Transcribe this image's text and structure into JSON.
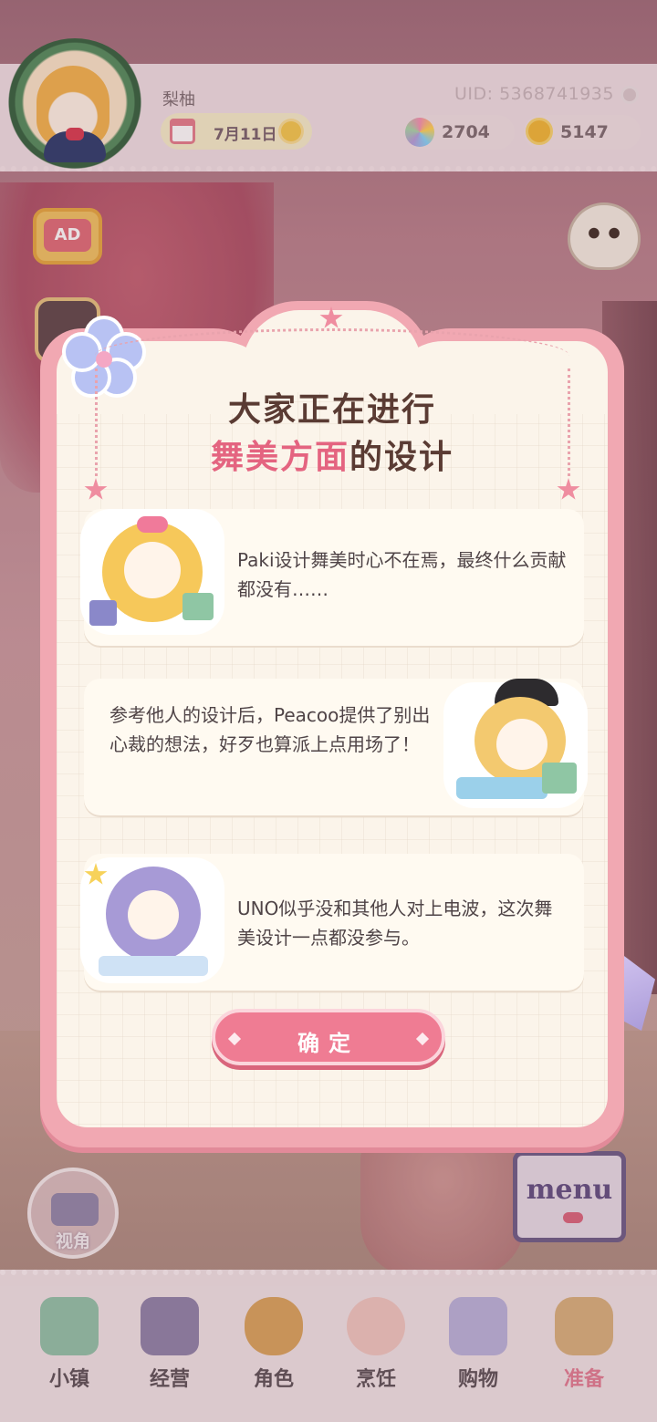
{
  "hud": {
    "player_name": "梨柚",
    "uid": "UID: 5368741935",
    "date": "7月11日",
    "gems": "2704",
    "coins": "5147"
  },
  "side": {
    "ad_label": "AD",
    "camera_label": "视角",
    "menu_label": "menu"
  },
  "dialog": {
    "title_line1": "大家正在进行",
    "title_line2_highlight": "舞美方面",
    "title_line2_rest": "的设计",
    "cards": [
      {
        "text": "Paki设计舞美时心不在焉，最终什么贡献都没有……",
        "character": "Paki"
      },
      {
        "text": "参考他人的设计后，Peacoo提供了别出心裁的想法，好歹也算派上点用场了！",
        "character": "Peacoo"
      },
      {
        "text": "UNO似乎没和其他人对上电波，这次舞美设计一点都没参与。",
        "character": "UNO"
      }
    ],
    "confirm_label": "确定"
  },
  "bottom_nav": [
    {
      "label": "小镇",
      "icon": "map-icon",
      "active": false
    },
    {
      "label": "经营",
      "icon": "shop-icon",
      "active": false
    },
    {
      "label": "角色",
      "icon": "character-icon",
      "active": false
    },
    {
      "label": "烹饪",
      "icon": "cooking-icon",
      "active": false
    },
    {
      "label": "购物",
      "icon": "shopping-bag-icon",
      "active": false
    },
    {
      "label": "准备",
      "icon": "basket-icon",
      "active": true
    }
  ],
  "colors": {
    "accent_pink": "#ef7c93",
    "title_highlight": "#e46480",
    "frame_pink": "#f1a8b2"
  }
}
